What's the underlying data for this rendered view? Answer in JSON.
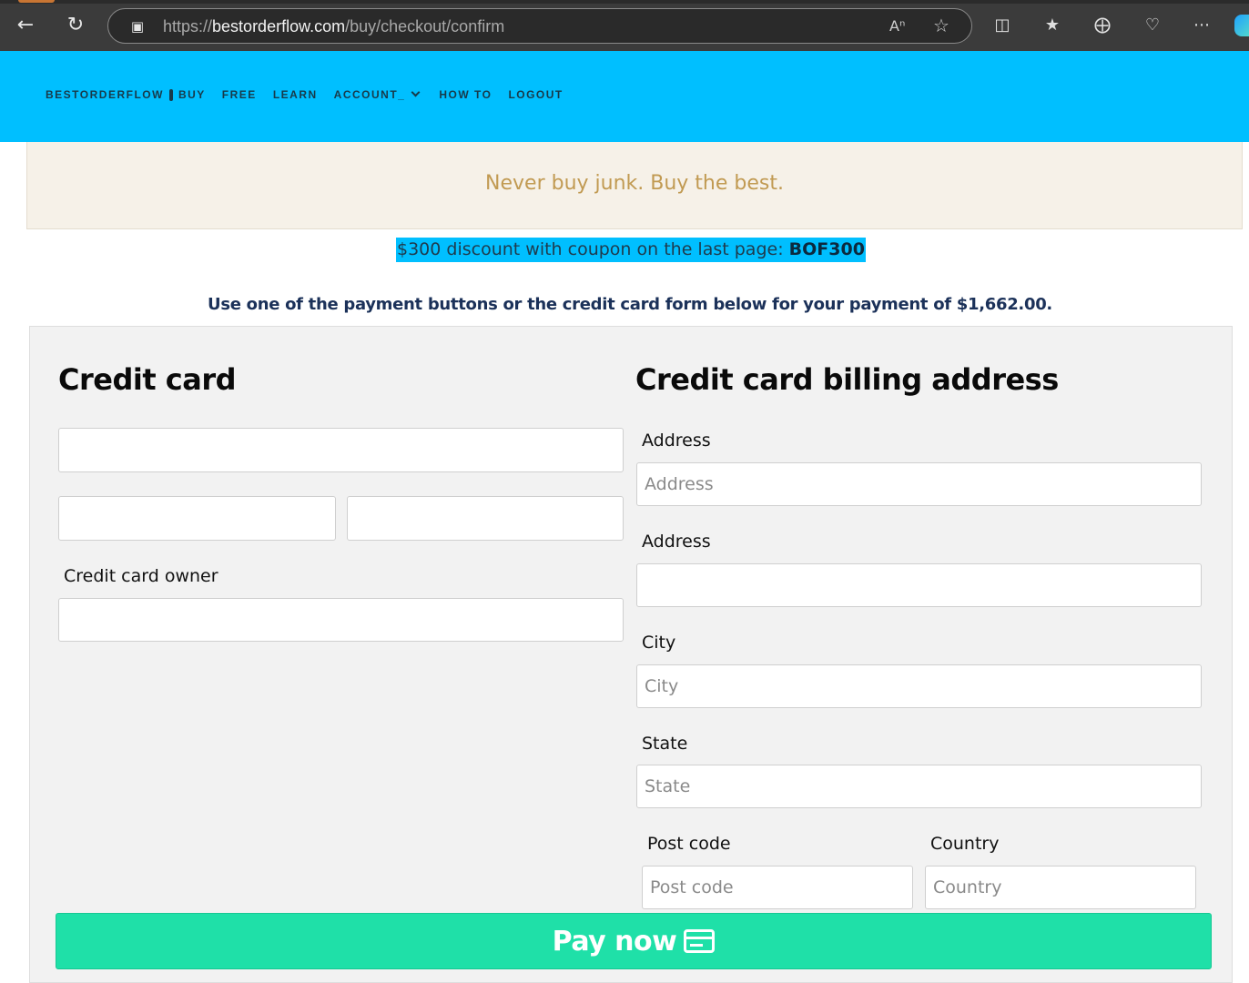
{
  "browser": {
    "url_prefix": "https://",
    "url_host": "bestorderflow.com",
    "url_path": "/buy/checkout/confirm",
    "icons": [
      "back-icon",
      "refresh-icon",
      "lock-icon",
      "read-aloud-icon",
      "favorite-star-icon",
      "split-screen-icon",
      "favorites-icon",
      "collections-icon",
      "browser-essentials-icon",
      "more-icon",
      "copilot-icon"
    ]
  },
  "nav": {
    "brand": "BESTORDERFLOW",
    "items": [
      "BUY",
      "FREE",
      "LEARN",
      "ACCOUNT_",
      "HOW TO",
      "LOGOUT"
    ]
  },
  "banner": {
    "text": "Never buy junk. Buy the best."
  },
  "discount": {
    "text": "$300 discount with coupon on the last page: ",
    "code": "BOF300"
  },
  "payment_instruction": "Use one of the payment buttons or the credit card form below for your payment of $1,662.00.",
  "credit_card": {
    "heading": "Credit card",
    "owner_label": "Credit card owner"
  },
  "billing": {
    "heading": "Credit card billing address",
    "address_label": "Address",
    "address_placeholder": "Address",
    "address2_label": "Address",
    "city_label": "City",
    "city_placeholder": "City",
    "state_label": "State",
    "state_placeholder": "State",
    "postcode_label": "Post code",
    "postcode_placeholder": "Post code",
    "country_label": "Country",
    "country_placeholder": "Country"
  },
  "pay_button": {
    "label": "Pay now"
  },
  "colors": {
    "header_bg": "#00bfff",
    "pay_button_bg": "#1fe0a8",
    "banner_text": "#c19a52",
    "instruction_text": "#1b3159"
  }
}
